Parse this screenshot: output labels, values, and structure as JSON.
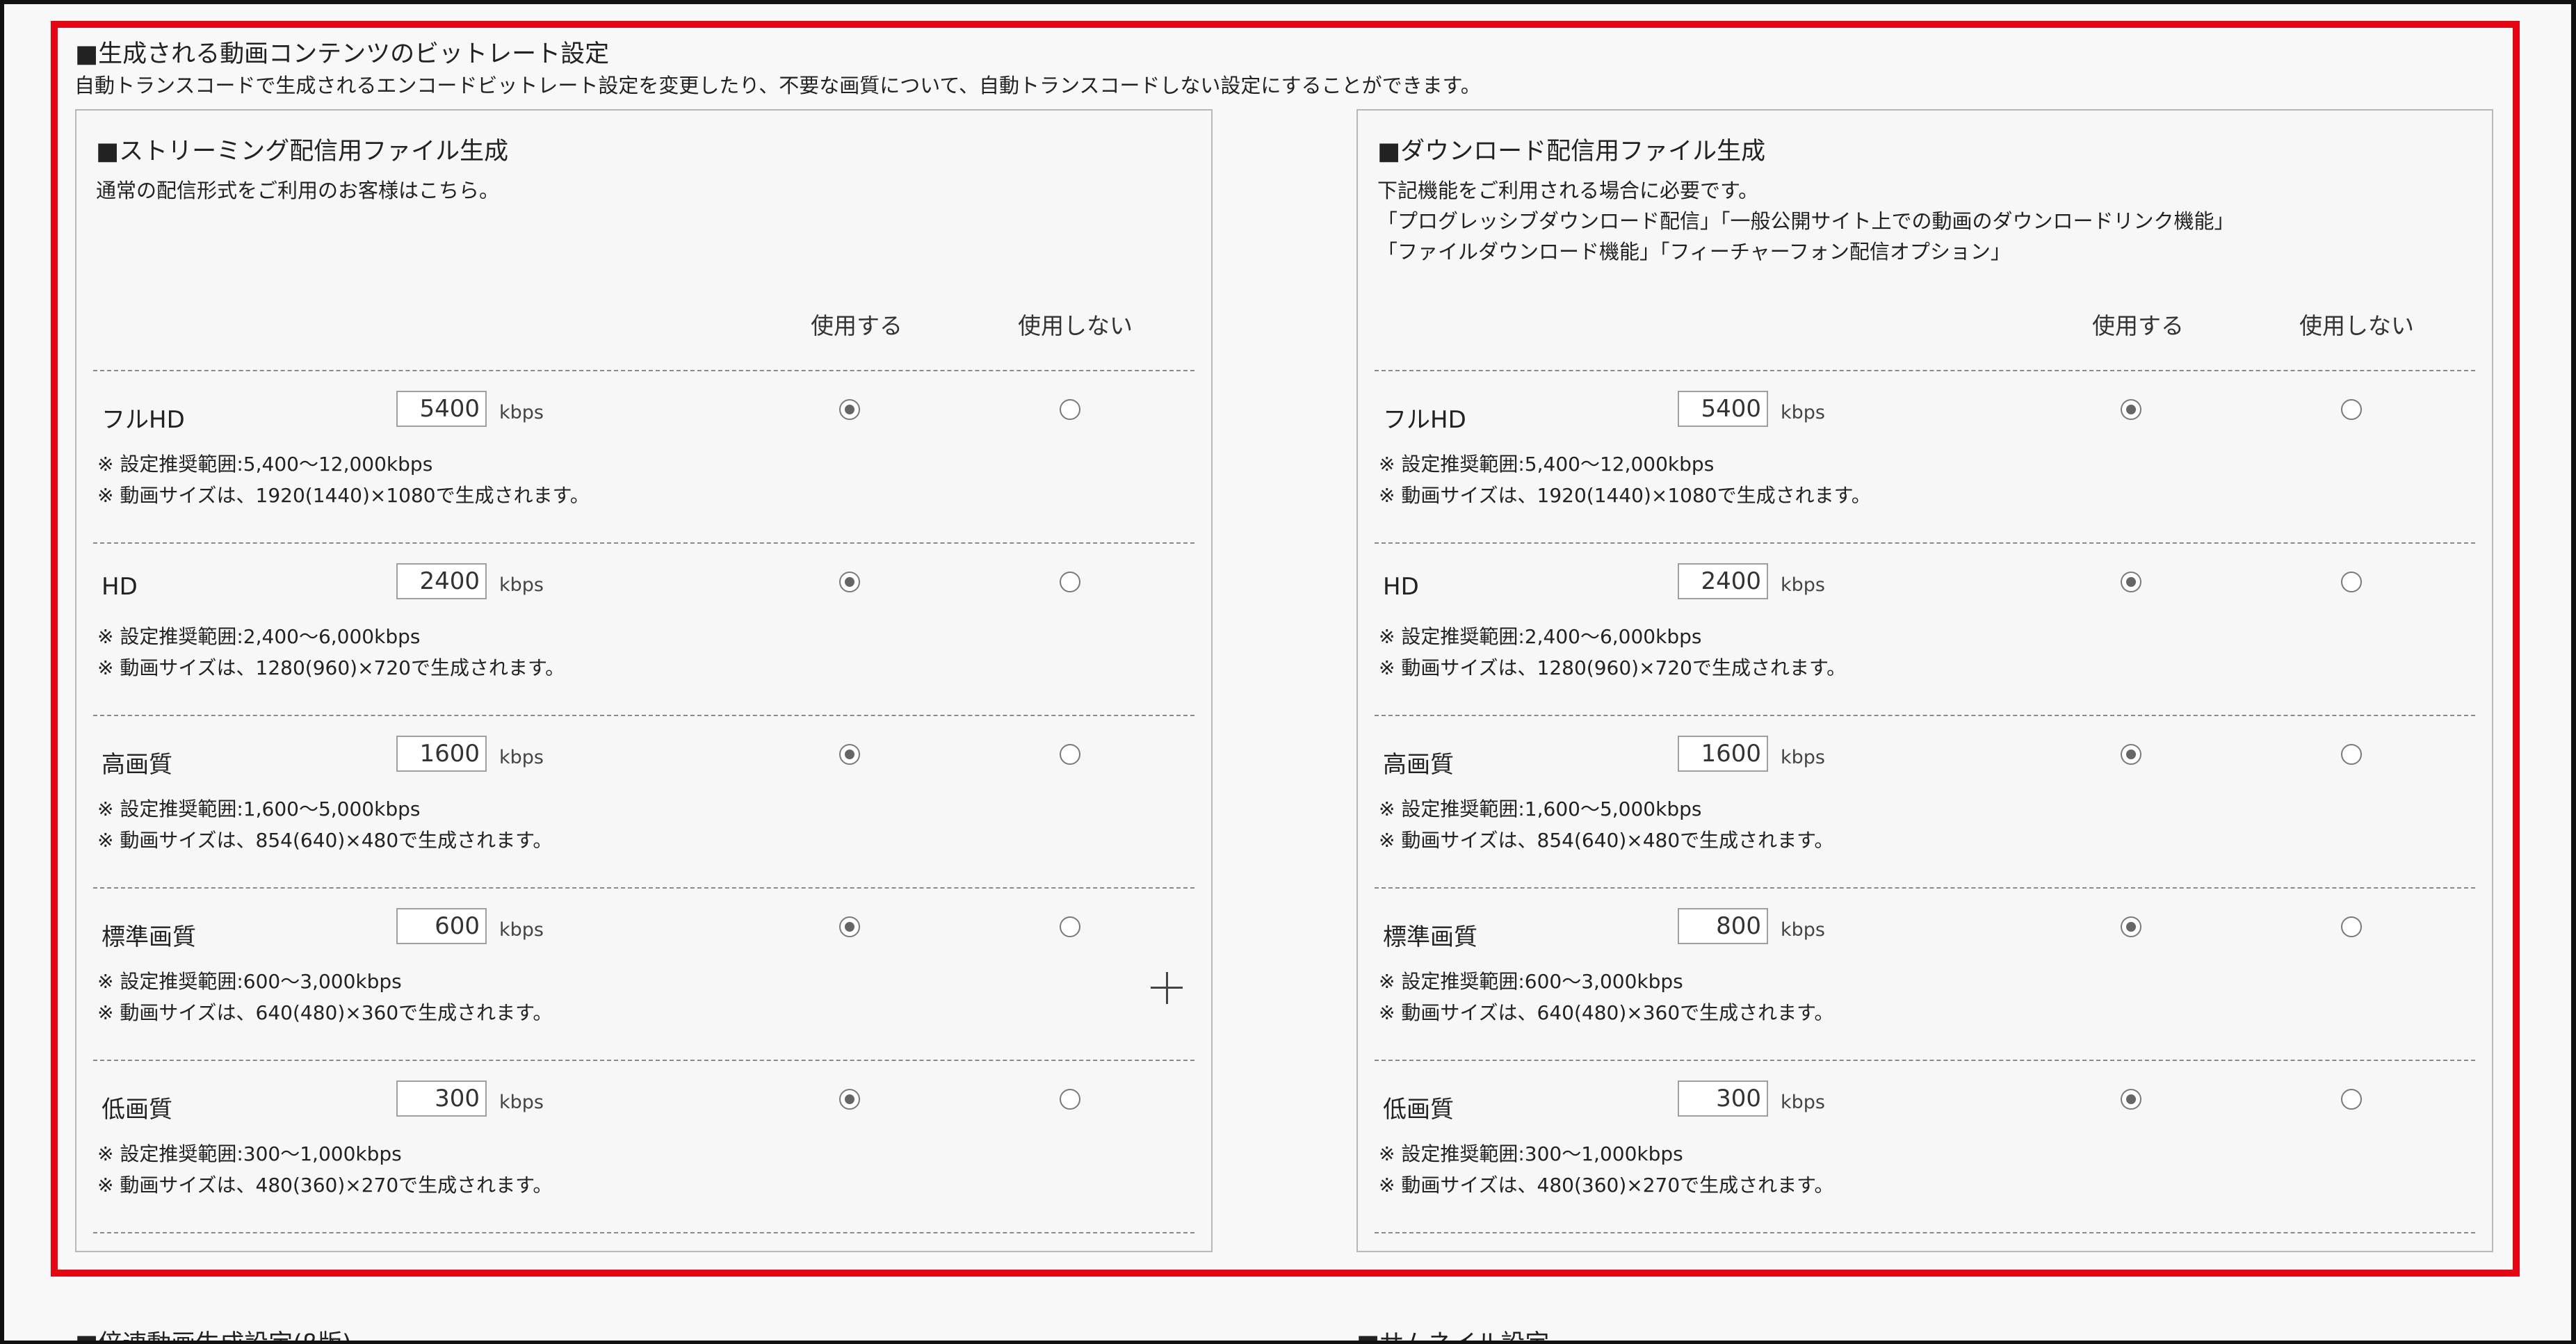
{
  "section": {
    "title": "■生成される動画コンテンツのビットレート設定",
    "description": "自動トランスコードで生成されるエンコードビットレート設定を変更したり、不要な画質について、自動トランスコードしない設定にすることができます。"
  },
  "column_headers": {
    "use": "使用する",
    "not_use": "使用しない"
  },
  "unit": "kbps",
  "streaming": {
    "title": "■ストリーミング配信用ファイル生成",
    "lines": [
      "通常の配信形式をご利用のお客様はこちら。"
    ],
    "rows": [
      {
        "label": "フルHD",
        "value": "5400",
        "note1": "※ 設定推奨範囲:5,400〜12,000kbps",
        "note2": "※ 動画サイズは、1920(1440)×1080で生成されます。",
        "selected": "use"
      },
      {
        "label": "HD",
        "value": "2400",
        "note1": "※ 設定推奨範囲:2,400〜6,000kbps",
        "note2": "※ 動画サイズは、1280(960)×720で生成されます。",
        "selected": "use"
      },
      {
        "label": "高画質",
        "value": "1600",
        "note1": "※ 設定推奨範囲:1,600〜5,000kbps",
        "note2": "※ 動画サイズは、854(640)×480で生成されます。",
        "selected": "use"
      },
      {
        "label": "標準画質",
        "value": "600",
        "note1": "※ 設定推奨範囲:600〜3,000kbps",
        "note2": "※ 動画サイズは、640(480)×360で生成されます。",
        "selected": "use"
      },
      {
        "label": "低画質",
        "value": "300",
        "note1": "※ 設定推奨範囲:300〜1,000kbps",
        "note2": "※ 動画サイズは、480(360)×270で生成されます。",
        "selected": "use"
      }
    ]
  },
  "download": {
    "title": "■ダウンロード配信用ファイル生成",
    "lines": [
      "下記機能をご利用される場合に必要です。",
      "「プログレッシブダウンロード配信」「一般公開サイト上での動画のダウンロードリンク機能」",
      "「ファイルダウンロード機能」「フィーチャーフォン配信オプション」"
    ],
    "rows": [
      {
        "label": "フルHD",
        "value": "5400",
        "note1": "※ 設定推奨範囲:5,400〜12,000kbps",
        "note2": "※ 動画サイズは、1920(1440)×1080で生成されます。",
        "selected": "use"
      },
      {
        "label": "HD",
        "value": "2400",
        "note1": "※ 設定推奨範囲:2,400〜6,000kbps",
        "note2": "※ 動画サイズは、1280(960)×720で生成されます。",
        "selected": "use"
      },
      {
        "label": "高画質",
        "value": "1600",
        "note1": "※ 設定推奨範囲:1,600〜5,000kbps",
        "note2": "※ 動画サイズは、854(640)×480で生成されます。",
        "selected": "use"
      },
      {
        "label": "標準画質",
        "value": "800",
        "note1": "※ 設定推奨範囲:600〜3,000kbps",
        "note2": "※ 動画サイズは、640(480)×360で生成されます。",
        "selected": "use"
      },
      {
        "label": "低画質",
        "value": "300",
        "note1": "※ 設定推奨範囲:300〜1,000kbps",
        "note2": "※ 動画サイズは、480(360)×270で生成されます。",
        "selected": "use"
      }
    ]
  },
  "next_sections": {
    "left": "■倍速動画生成設定(β版)",
    "right": "■サムネイル設定"
  },
  "colors": {
    "highlight": "#e30613",
    "panel_border": "#b8b8b8",
    "background": "#f8f8f8"
  }
}
